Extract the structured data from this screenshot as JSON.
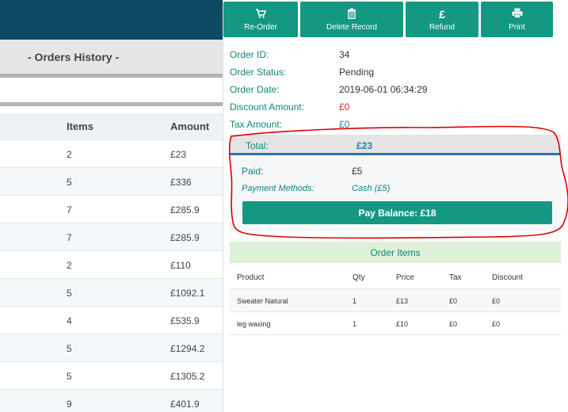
{
  "left": {
    "page_title": "- Orders History -",
    "columns": {
      "items": "Items",
      "amount": "Amount"
    },
    "rows": [
      {
        "items": "2",
        "amount": "£23"
      },
      {
        "items": "5",
        "amount": "£336"
      },
      {
        "items": "7",
        "amount": "£285.9"
      },
      {
        "items": "7",
        "amount": "£285.9"
      },
      {
        "items": "2",
        "amount": "£110"
      },
      {
        "items": "5",
        "amount": "£1092.1"
      },
      {
        "items": "4",
        "amount": "£535.9"
      },
      {
        "items": "5",
        "amount": "£1294.2"
      },
      {
        "items": "5",
        "amount": "£1305.2"
      },
      {
        "items": "9",
        "amount": "£401.9"
      }
    ]
  },
  "toolbar": {
    "buttons": [
      {
        "label": "Re-Order",
        "icon": "cart-icon"
      },
      {
        "label": "Delete Record",
        "icon": "trash-icon"
      },
      {
        "label": "Refund",
        "icon": "pound-icon"
      },
      {
        "label": "Print",
        "icon": "printer-icon"
      }
    ]
  },
  "order": {
    "id_label": "Order ID:",
    "id": "34",
    "status_label": "Order Status:",
    "status": "Pending",
    "date_label": "Order Date:",
    "date": "2019-06-01 06:34:29",
    "discount_label": "Discount Amount:",
    "discount": "£0",
    "tax_label": "Tax Amount:",
    "tax": "£0",
    "total_label": "Total:",
    "total": "£23",
    "paid_label": "Paid:",
    "paid": "£5",
    "methods_label": "Payment Methods:",
    "methods": "Cash (£5)",
    "pay_balance": "Pay Balance:  £18"
  },
  "items": {
    "title": "Order Items",
    "columns": {
      "product": "Product",
      "qty": "Qty",
      "price": "Price",
      "tax": "Tax",
      "discount": "Discount"
    },
    "rows": [
      {
        "product": "Sweater Natural",
        "qty": "1",
        "price": "£13",
        "tax": "£0",
        "discount": "£0"
      },
      {
        "product": "leg waxing",
        "qty": "1",
        "price": "£10",
        "tax": "£0",
        "discount": "£0"
      }
    ]
  },
  "colors": {
    "accent": "#149882",
    "header": "#0d4a63",
    "annotation": "#e00000"
  }
}
